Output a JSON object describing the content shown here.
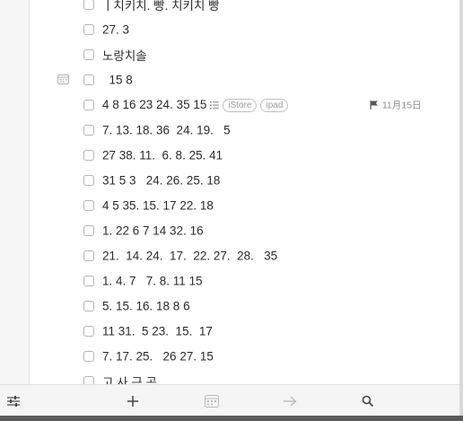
{
  "tasks": [
    {
      "text": "ㅣ치키치. 빵. 치키치 빵"
    },
    {
      "text": "27. 3"
    },
    {
      "text": "노랑치솔"
    },
    {
      "text": "  15 8"
    },
    {
      "text": "4 8 16 23 24. 35 15",
      "tags": [
        "iStore",
        "ipad"
      ],
      "due": "11月15日"
    },
    {
      "text": "7. 13. 18. 36  24. 19.   5"
    },
    {
      "text": "27 38. 11.  6. 8. 25. 41"
    },
    {
      "text": "31 5 3   24. 26. 25. 18"
    },
    {
      "text": "4 5 35. 15. 17 22. 18"
    },
    {
      "text": "1. 22 6 7 14 32. 16"
    },
    {
      "text": "21.  14. 24.  17.  22. 27.  28.   35"
    },
    {
      "text": "1. 4. 7   7. 8. 11 15"
    },
    {
      "text": "5. 15. 16. 18 8 6"
    },
    {
      "text": "11 31.  5 23.  15.  17"
    },
    {
      "text": "7. 17. 25.   26 27. 15"
    },
    {
      "text": "고 사 근 곡"
    }
  ],
  "colors": {
    "flag": "#555555",
    "tag_border": "#bfbfbf",
    "toolbar_bg": "#f5f5f5"
  },
  "icons": {
    "toolbar": [
      "filter-sliders-icon",
      "plus-icon",
      "calendar-icon",
      "arrow-right-icon",
      "search-icon"
    ]
  }
}
